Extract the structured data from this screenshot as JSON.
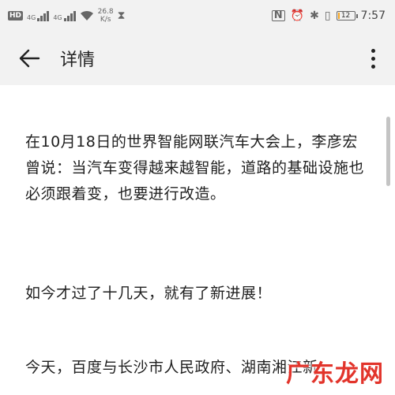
{
  "status_bar": {
    "hd": "HD",
    "net1": "4G",
    "net2": "4G",
    "speed_value": "26.8",
    "speed_unit": "K/s",
    "battery_level": "12",
    "battery_fraction": 0.12,
    "time": "7:57",
    "icons": [
      "nfc-icon",
      "alarm-icon",
      "bluetooth-icon",
      "vibrate-icon",
      "battery-icon"
    ]
  },
  "app_bar": {
    "title": "详情",
    "back_icon": "arrow-left-icon",
    "more_icon": "more-vertical-icon"
  },
  "article": {
    "paragraphs": [
      "在10月18日的世界智能网联汽车大会上，李彦宏曾说：当汽车变得越来越智能，道路的基础设施也必须跟着变，也要进行改造。",
      "如今才过了十几天，就有了新进展！",
      "今天，百度与长沙市人民政府、湖南湘江新"
    ]
  },
  "watermark": "广东龙网",
  "colors": {
    "bar_bg": "#f2f2f2",
    "text": "#1f1f1f",
    "battery_low": "#f5a623",
    "watermark": "#e2342b"
  }
}
